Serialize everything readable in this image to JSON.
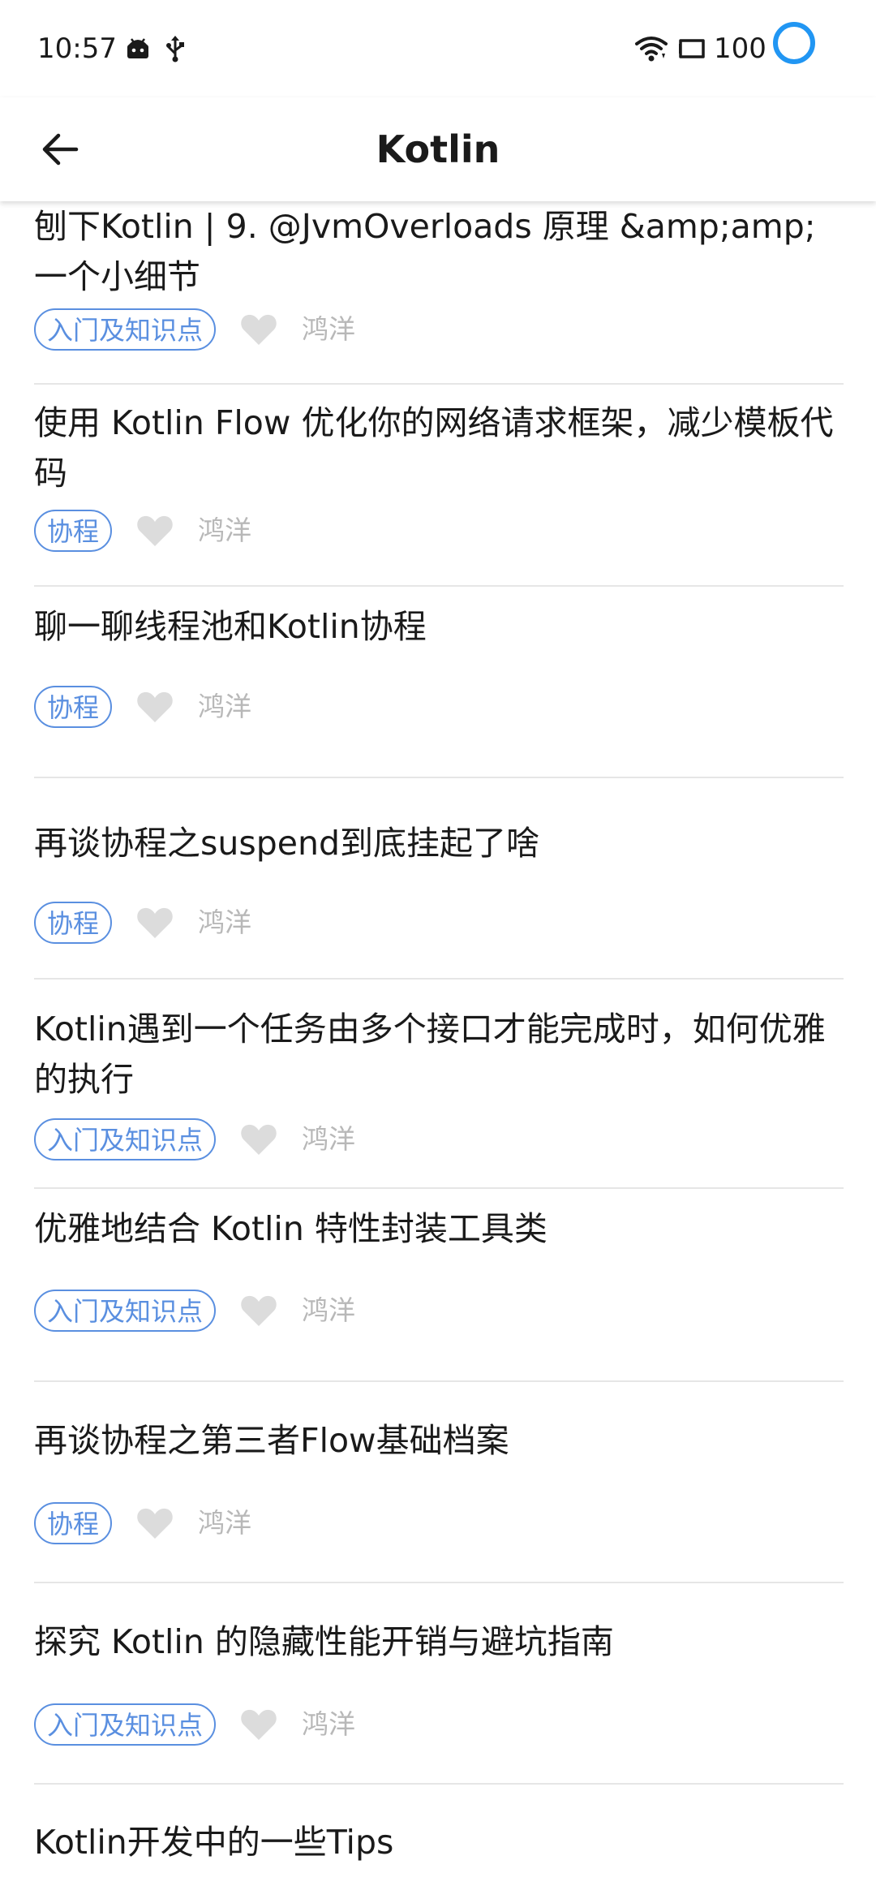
{
  "status_bar": {
    "time": "10:57",
    "battery": "100",
    "accent_color": "#2196F3"
  },
  "app_bar": {
    "title": "Kotlin",
    "back_icon": "arrow-left-icon"
  },
  "colors": {
    "tag_blue": "#5a8fe0",
    "author_gray": "#b8b8b8",
    "heart_gray": "#dcdcdc",
    "divider": "#e6e6e6"
  },
  "articles": [
    {
      "title": "刨下Kotlin | 9. @JvmOverloads 原理 &amp;amp; 一个小细节",
      "tag": "入门及知识点",
      "author": "鸿洋"
    },
    {
      "title": "使用 Kotlin Flow 优化你的网络请求框架，减少模板代码",
      "tag": "协程",
      "author": "鸿洋"
    },
    {
      "title": "聊一聊线程池和Kotlin协程",
      "tag": "协程",
      "author": "鸿洋"
    },
    {
      "title": "再谈协程之suspend到底挂起了啥",
      "tag": "协程",
      "author": "鸿洋"
    },
    {
      "title": "Kotlin遇到一个任务由多个接口才能完成时，如何优雅的执行",
      "tag": "入门及知识点",
      "author": "鸿洋"
    },
    {
      "title": "优雅地结合 Kotlin 特性封装工具类",
      "tag": "入门及知识点",
      "author": "鸿洋"
    },
    {
      "title": "再谈协程之第三者Flow基础档案",
      "tag": "协程",
      "author": "鸿洋"
    },
    {
      "title": "探究 Kotlin 的隐藏性能开销与避坑指南",
      "tag": "入门及知识点",
      "author": "鸿洋"
    },
    {
      "title": "Kotlin开发中的一些Tips",
      "tag": "",
      "author": ""
    }
  ]
}
